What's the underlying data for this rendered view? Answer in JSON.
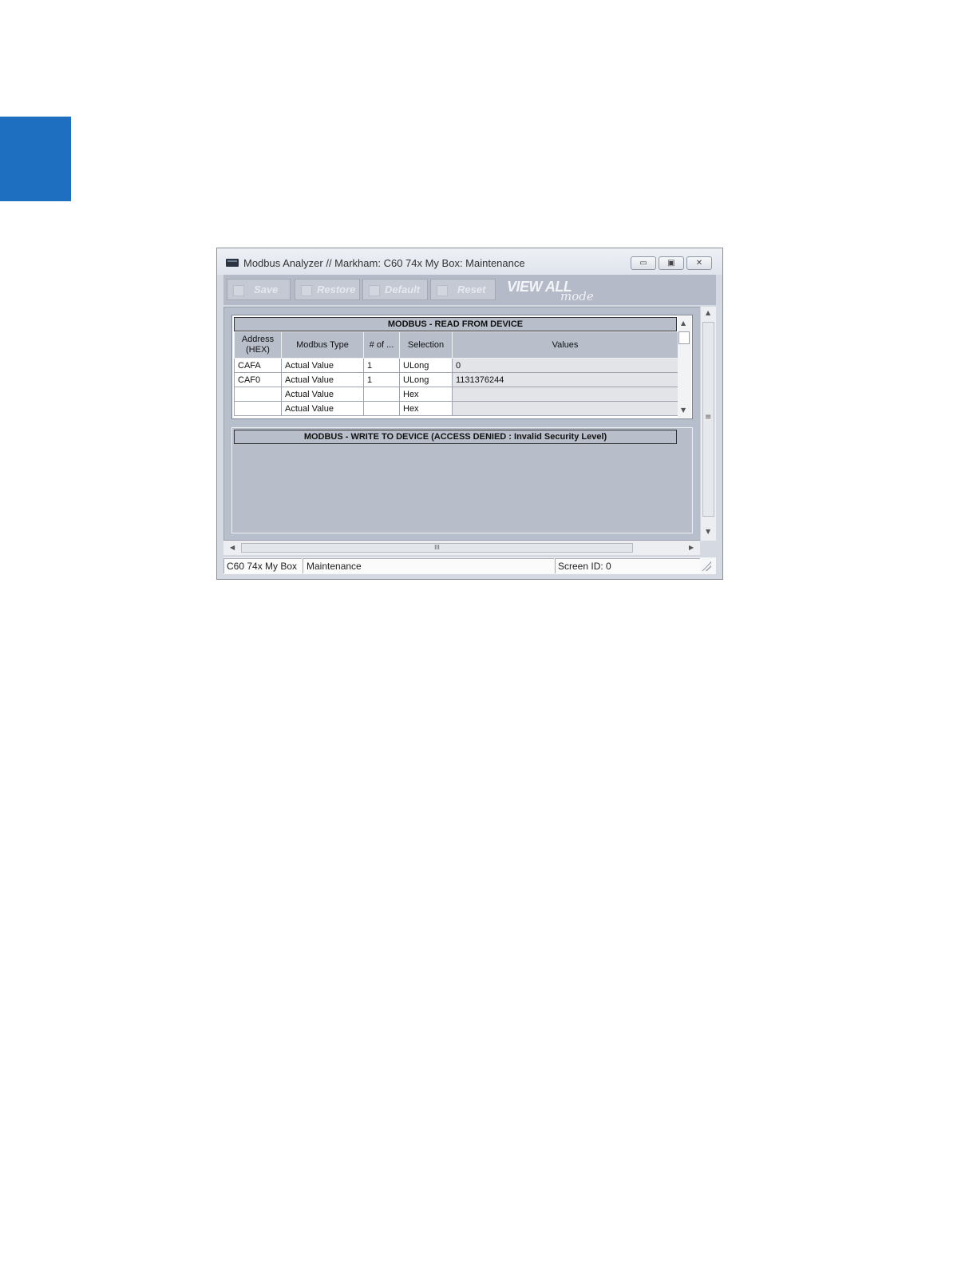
{
  "window": {
    "title": "Modbus Analyzer // Markham: C60 74x My Box: Maintenance",
    "buttons": {
      "minimize": "▭",
      "maximize": "▣",
      "close": "✕"
    }
  },
  "toolbar": {
    "save_label": "Save",
    "restore_label": "Restore",
    "default_label": "Default",
    "reset_label": "Reset",
    "view_all_label": "VIEW ALL",
    "mode_label": "mode"
  },
  "read_panel": {
    "header": "MODBUS - READ FROM DEVICE",
    "columns": {
      "address_line1": "Address",
      "address_line2": "(HEX)",
      "modbus_type": "Modbus Type",
      "num_of": "# of ...",
      "selection": "Selection",
      "values": "Values"
    },
    "rows": [
      {
        "address": "CAFA",
        "type": "Actual Value",
        "count": "1",
        "selection": "ULong",
        "value": "0"
      },
      {
        "address": "CAF0",
        "type": "Actual Value",
        "count": "1",
        "selection": "ULong",
        "value": "1131376244"
      },
      {
        "address": "",
        "type": "Actual Value",
        "count": "",
        "selection": "Hex",
        "value": ""
      },
      {
        "address": "",
        "type": "Actual Value",
        "count": "",
        "selection": "Hex",
        "value": ""
      }
    ]
  },
  "write_panel": {
    "header": "MODBUS - WRITE TO DEVICE  (ACCESS DENIED : Invalid Security Level)"
  },
  "scrollbars": {
    "hscroll_grip": "III",
    "vscroll_grip": "≡"
  },
  "status_bar": {
    "device": "C60 74x My Box",
    "mode": "Maintenance",
    "screen_id": "Screen ID: 0"
  },
  "colors": {
    "side_tab": "#1f6fc1",
    "panel_bg": "#b8bfcc",
    "header_bg": "#b9bfca"
  }
}
